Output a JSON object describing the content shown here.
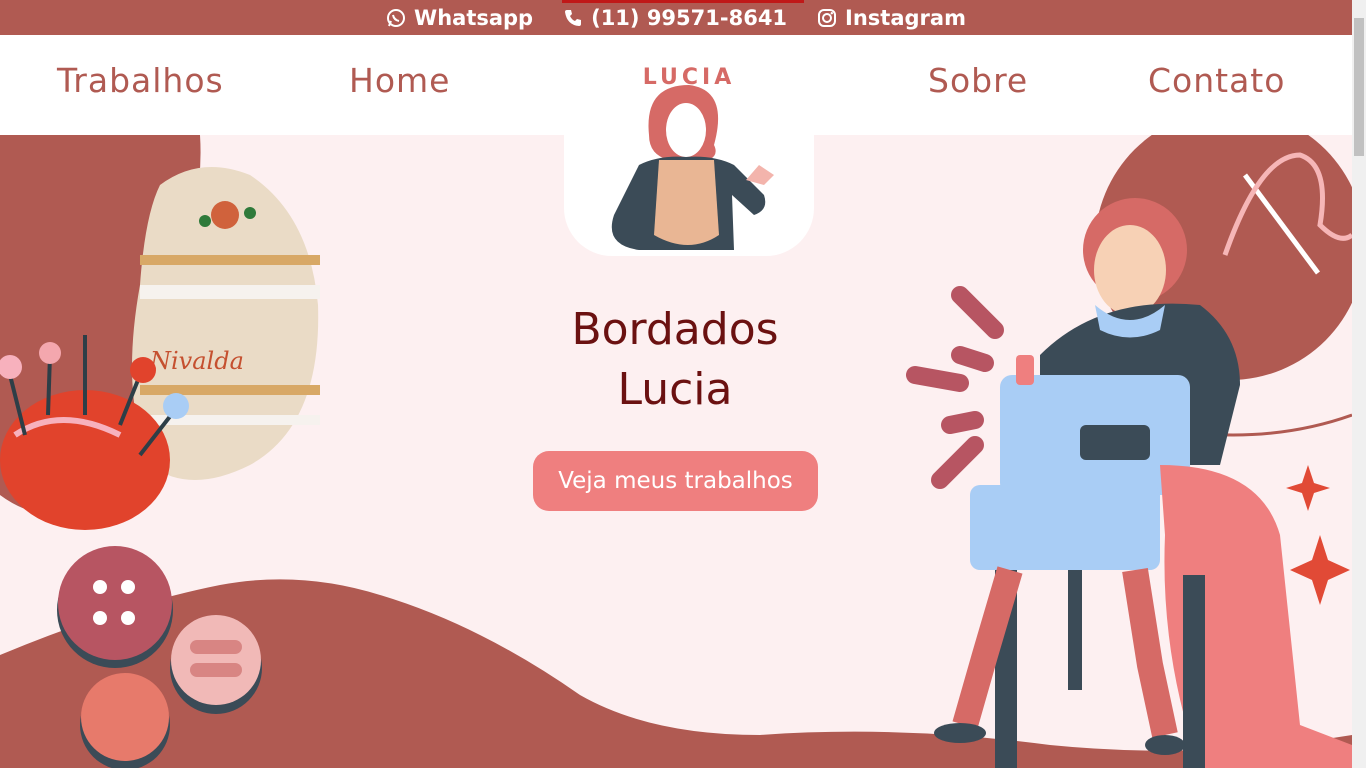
{
  "topbar": {
    "whatsapp": "Whatsapp",
    "phone": "(11) 99571-8641",
    "instagram": "Instagram"
  },
  "nav": {
    "trabalhos": "Trabalhos",
    "home": "Home",
    "sobre": "Sobre",
    "contato": "Contato"
  },
  "logo": {
    "text": "LUCIA"
  },
  "hero": {
    "title_line1": "Bordados",
    "title_line2": "Lucia",
    "cta": "Veja meus trabalhos",
    "photo_name": "Nivalda"
  },
  "colors": {
    "brand": "#b05a52",
    "title": "#6b1111",
    "button": "#ef7f7f",
    "background": "#fdf0f1"
  }
}
